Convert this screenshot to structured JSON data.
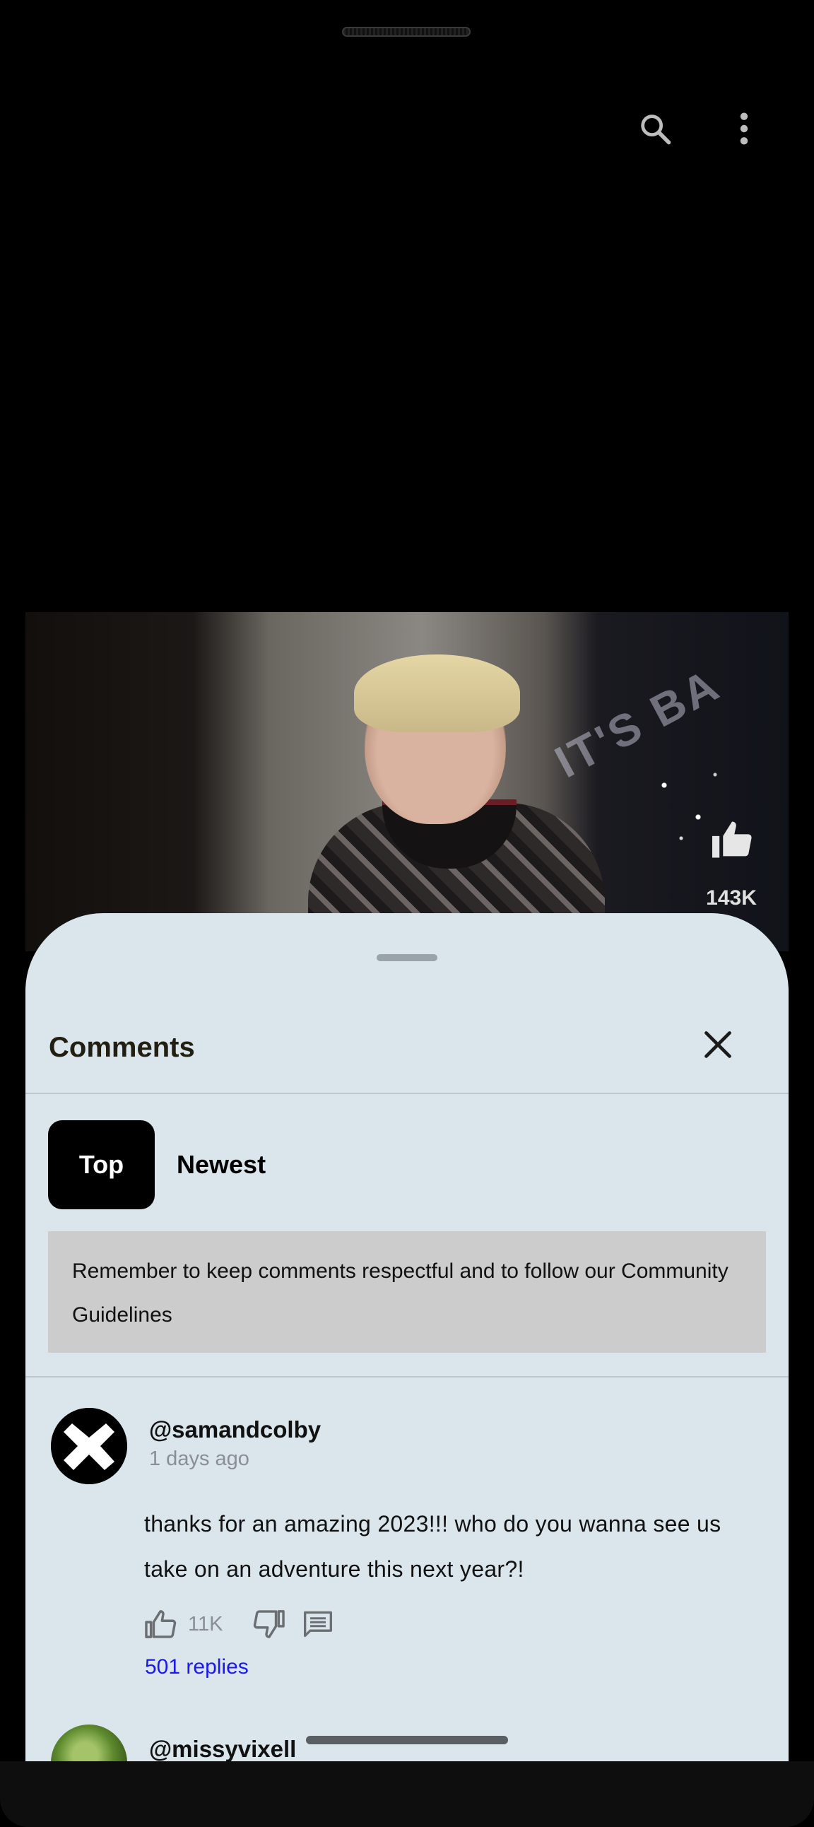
{
  "topbar": {
    "search_icon": "search-icon",
    "more_icon": "more-vert-icon"
  },
  "video": {
    "like_icon": "thumb-up-icon",
    "like_count": "143K"
  },
  "comments_sheet": {
    "title": "Comments",
    "close_icon": "close-icon",
    "sort_chips": [
      {
        "label": "Top",
        "selected": true
      },
      {
        "label": "Newest",
        "selected": false
      }
    ],
    "guidelines_notice": "Remember to keep comments respectful and to follow our Community Guidelines",
    "comments": [
      {
        "username": "@samandcolby",
        "timestamp": "1 days ago",
        "text": "thanks for an amazing 2023!!! who do you wanna see us take on an adventure this next year?!",
        "like_count": "11K",
        "replies_label": "501 replies"
      },
      {
        "username": "@missyvixell"
      }
    ]
  },
  "colors": {
    "sheet_bg": "#dbe5ec",
    "chip_selected_bg": "#000000",
    "notice_bg": "#cccccc",
    "link": "#1a1af0"
  }
}
